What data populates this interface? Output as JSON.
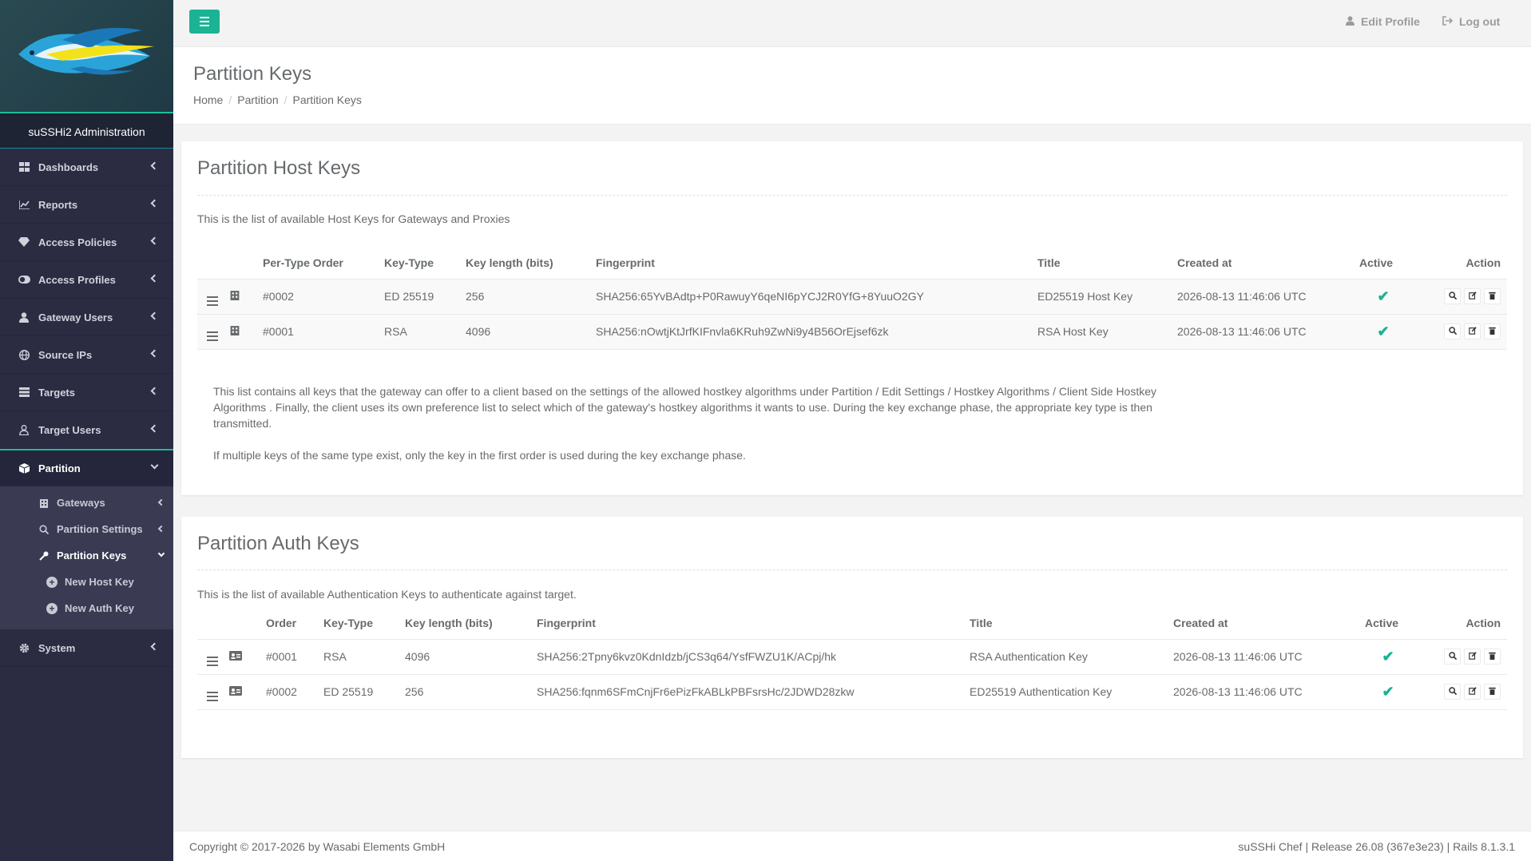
{
  "brand": {
    "title": "suSSHi2 Administration"
  },
  "sidebar": {
    "items": [
      {
        "label": "Dashboards",
        "icon": "dashboard-icon"
      },
      {
        "label": "Reports",
        "icon": "chart-icon"
      },
      {
        "label": "Access Policies",
        "icon": "diamond-icon"
      },
      {
        "label": "Access Profiles",
        "icon": "toggle-icon"
      },
      {
        "label": "Gateway Users",
        "icon": "user-icon"
      },
      {
        "label": "Source IPs",
        "icon": "globe-icon"
      },
      {
        "label": "Targets",
        "icon": "server-icon"
      },
      {
        "label": "Target Users",
        "icon": "user-outline-icon"
      },
      {
        "label": "Partition",
        "icon": "cube-icon"
      },
      {
        "label": "System",
        "icon": "gear-icon"
      }
    ],
    "partition_sub": [
      {
        "label": "Gateways",
        "icon": "building-icon"
      },
      {
        "label": "Partition Settings",
        "icon": "search-icon"
      },
      {
        "label": "Partition Keys",
        "icon": "key-icon"
      }
    ],
    "keys_sub": [
      {
        "label": "New Host Key",
        "icon": "plus-circle-icon"
      },
      {
        "label": "New Auth Key",
        "icon": "plus-circle-icon"
      }
    ]
  },
  "topbar": {
    "edit_profile": "Edit Profile",
    "logout": "Log out"
  },
  "page": {
    "title": "Partition Keys",
    "breadcrumb": [
      "Home",
      "Partition",
      "Partition Keys"
    ],
    "breadcrumb_sep": "/"
  },
  "host_keys": {
    "title": "Partition Host Keys",
    "intro": "This is the list of available Host Keys for Gateways and Proxies",
    "headers": [
      "Per-Type Order",
      "Key-Type",
      "Key length (bits)",
      "Fingerprint",
      "Title",
      "Created at",
      "Active",
      "Action"
    ],
    "rows": [
      {
        "order": "#0002",
        "type": "ED 25519",
        "length": "256",
        "fingerprint": "SHA256:65YvBAdtp+P0RawuyY6qeNI6pYCJ2R0YfG+8YuuO2GY",
        "title": "ED25519 Host Key",
        "created": "2026-08-13 11:46:06 UTC"
      },
      {
        "order": "#0001",
        "type": "RSA",
        "length": "4096",
        "fingerprint": "SHA256:nOwtjKtJrfKIFnvla6KRuh9ZwNi9y4B56OrEjsef6zk",
        "title": "RSA Host Key",
        "created": "2026-08-13 11:46:06 UTC"
      }
    ],
    "note1": "This list contains all keys that the gateway can offer to a client based on the settings of the allowed hostkey algorithms under Partition / Edit Settings / Hostkey Algorithms / Client Side Hostkey Algorithms . Finally, the client uses its own preference list to select which of the gateway's hostkey algorithms it wants to use. During the key exchange phase, the appropriate key type is then transmitted.",
    "note2": "If multiple keys of the same type exist, only the key in the first order is used during the key exchange phase."
  },
  "auth_keys": {
    "title": "Partition Auth Keys",
    "intro": "This is the list of available Authentication Keys to authenticate against target.",
    "headers": [
      "Order",
      "Key-Type",
      "Key length (bits)",
      "Fingerprint",
      "Title",
      "Created at",
      "Active",
      "Action"
    ],
    "rows": [
      {
        "order": "#0001",
        "type": "RSA",
        "length": "4096",
        "fingerprint": "SHA256:2Tpny6kvz0KdnIdzb/jCS3q64/YsfFWZU1K/ACpj/hk",
        "title": "RSA Authentication Key",
        "created": "2026-08-13 11:46:06 UTC"
      },
      {
        "order": "#0002",
        "type": "ED 25519",
        "length": "256",
        "fingerprint": "SHA256:fqnm6SFmCnjFr6ePizFkABLkPBFsrsHc/2JDWD28zkw",
        "title": "ED25519 Authentication Key",
        "created": "2026-08-13 11:46:06 UTC"
      }
    ]
  },
  "footer": {
    "copyright": "Copyright © 2017-2026 by Wasabi Elements GmbH",
    "release": "suSSHi Chef | Release 26.08 (367e3e23) | Rails 8.1.3.1"
  },
  "colors": {
    "accent": "#1ab394",
    "sidebar": "#2b2c42",
    "check": "#1ab394"
  }
}
